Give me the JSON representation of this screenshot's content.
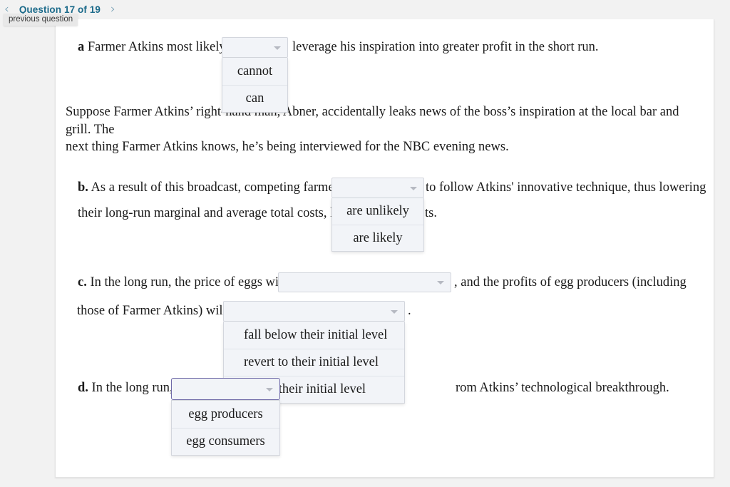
{
  "header": {
    "prev_arrow": "‹",
    "next_arrow": "›",
    "counter": "Question 17 of 19",
    "tooltip": "previous question"
  },
  "parts": {
    "a": {
      "label": "a",
      "text_before": "Farmer Atkins most likely",
      "text_after": "leverage his inspiration into greater profit in the short run.",
      "options": [
        "cannot",
        "can"
      ],
      "selected": ""
    },
    "b": {
      "label": "b.",
      "text_before": "As a result of this broadcast, competing farmers",
      "text_after": "to follow Atkins' innovative technique, thus lowering",
      "line2_before": "their long-run marginal and average total costs, lead",
      "line2_after": "ts.",
      "options": [
        "are unlikely",
        "are likely"
      ],
      "selected": ""
    },
    "c": {
      "label": "c.",
      "text_before": "In the long run, the price of eggs will",
      "text_mid": ", and the profits of egg producers (including",
      "line2_before": "those of Farmer Atkins) will",
      "line2_after": ".",
      "options": [
        "fall below their initial level",
        "revert to their initial level",
        "above their initial level"
      ],
      "selected_price": "",
      "selected_profit": ""
    },
    "d": {
      "label": "d.",
      "text_before": "In the long run,",
      "text_after": "rom Atkins’ technological breakthrough.",
      "options": [
        "egg producers",
        "egg consumers"
      ],
      "selected": ""
    }
  },
  "narrative": {
    "line1": "Suppose Farmer Atkins’ right-hand man, Abner, accidentally leaks news of the boss’s inspiration at the local bar and grill. The",
    "line2": "next thing Farmer Atkins knows, he’s being interviewed for the NBC evening news."
  },
  "colors": {
    "accent": "#1b6a8a",
    "select_bg": "#f2f4f8",
    "select_border": "#d3d6dd",
    "focus_border": "#6f6aa8",
    "page_bg": "#f2f2f2"
  }
}
